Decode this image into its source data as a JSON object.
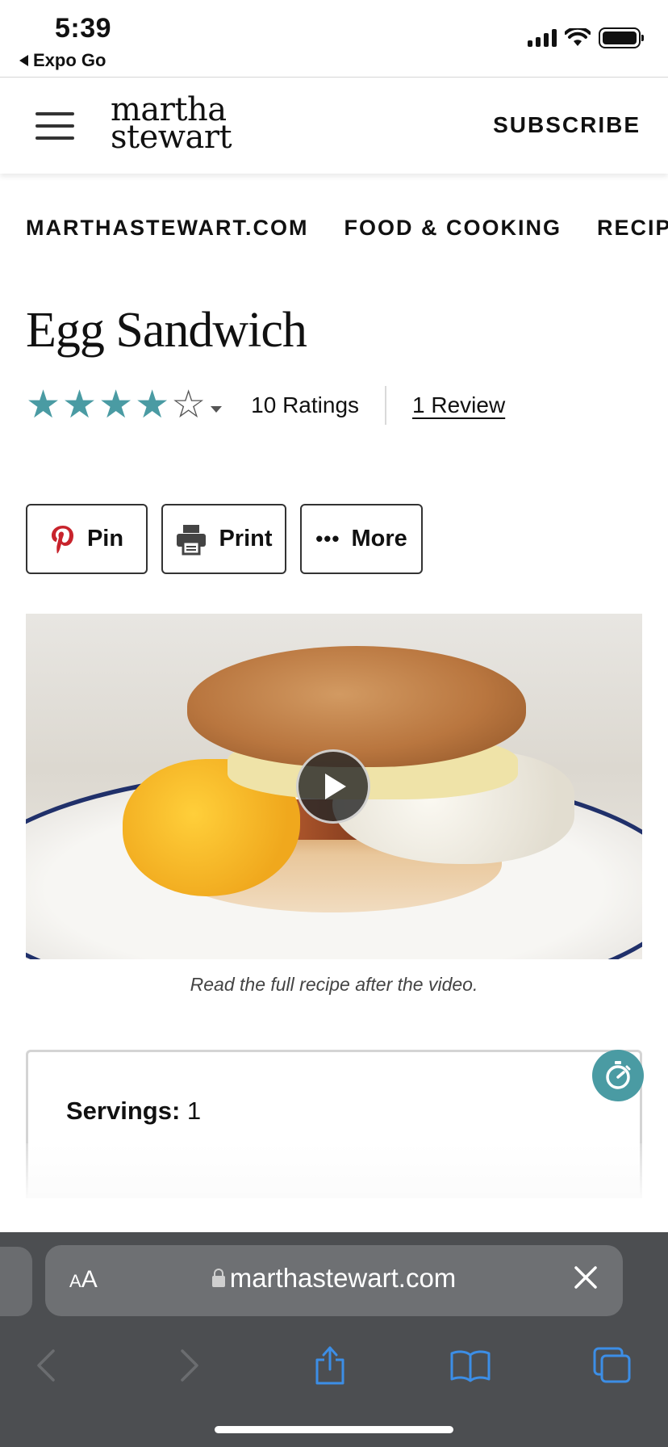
{
  "status_bar": {
    "time": "5:39",
    "back_app": "Expo Go"
  },
  "header": {
    "logo_line1": "martha",
    "logo_line2": "stewart",
    "subscribe": "SUBSCRIBE"
  },
  "breadcrumb": {
    "items": [
      "MARTHASTEWART.COM",
      "FOOD & COOKING",
      "RECIPES"
    ]
  },
  "recipe": {
    "title": "Egg Sandwich",
    "rating": 4,
    "rating_max": 5,
    "ratings_count": "10 Ratings",
    "reviews_link": "1 Review"
  },
  "actions": {
    "pin": "Pin",
    "print": "Print",
    "more": "More"
  },
  "video": {
    "caption": "Read the full recipe after the video."
  },
  "card": {
    "servings_label": "Servings:",
    "servings_value": " 1"
  },
  "browser": {
    "text_size_label": "AA",
    "url": "marthastewart.com"
  },
  "colors": {
    "accent": "#4a9ba3",
    "pinterest": "#c8232c",
    "browser_bar": "#4c4e51",
    "browser_icon": "#3c8ee6"
  }
}
